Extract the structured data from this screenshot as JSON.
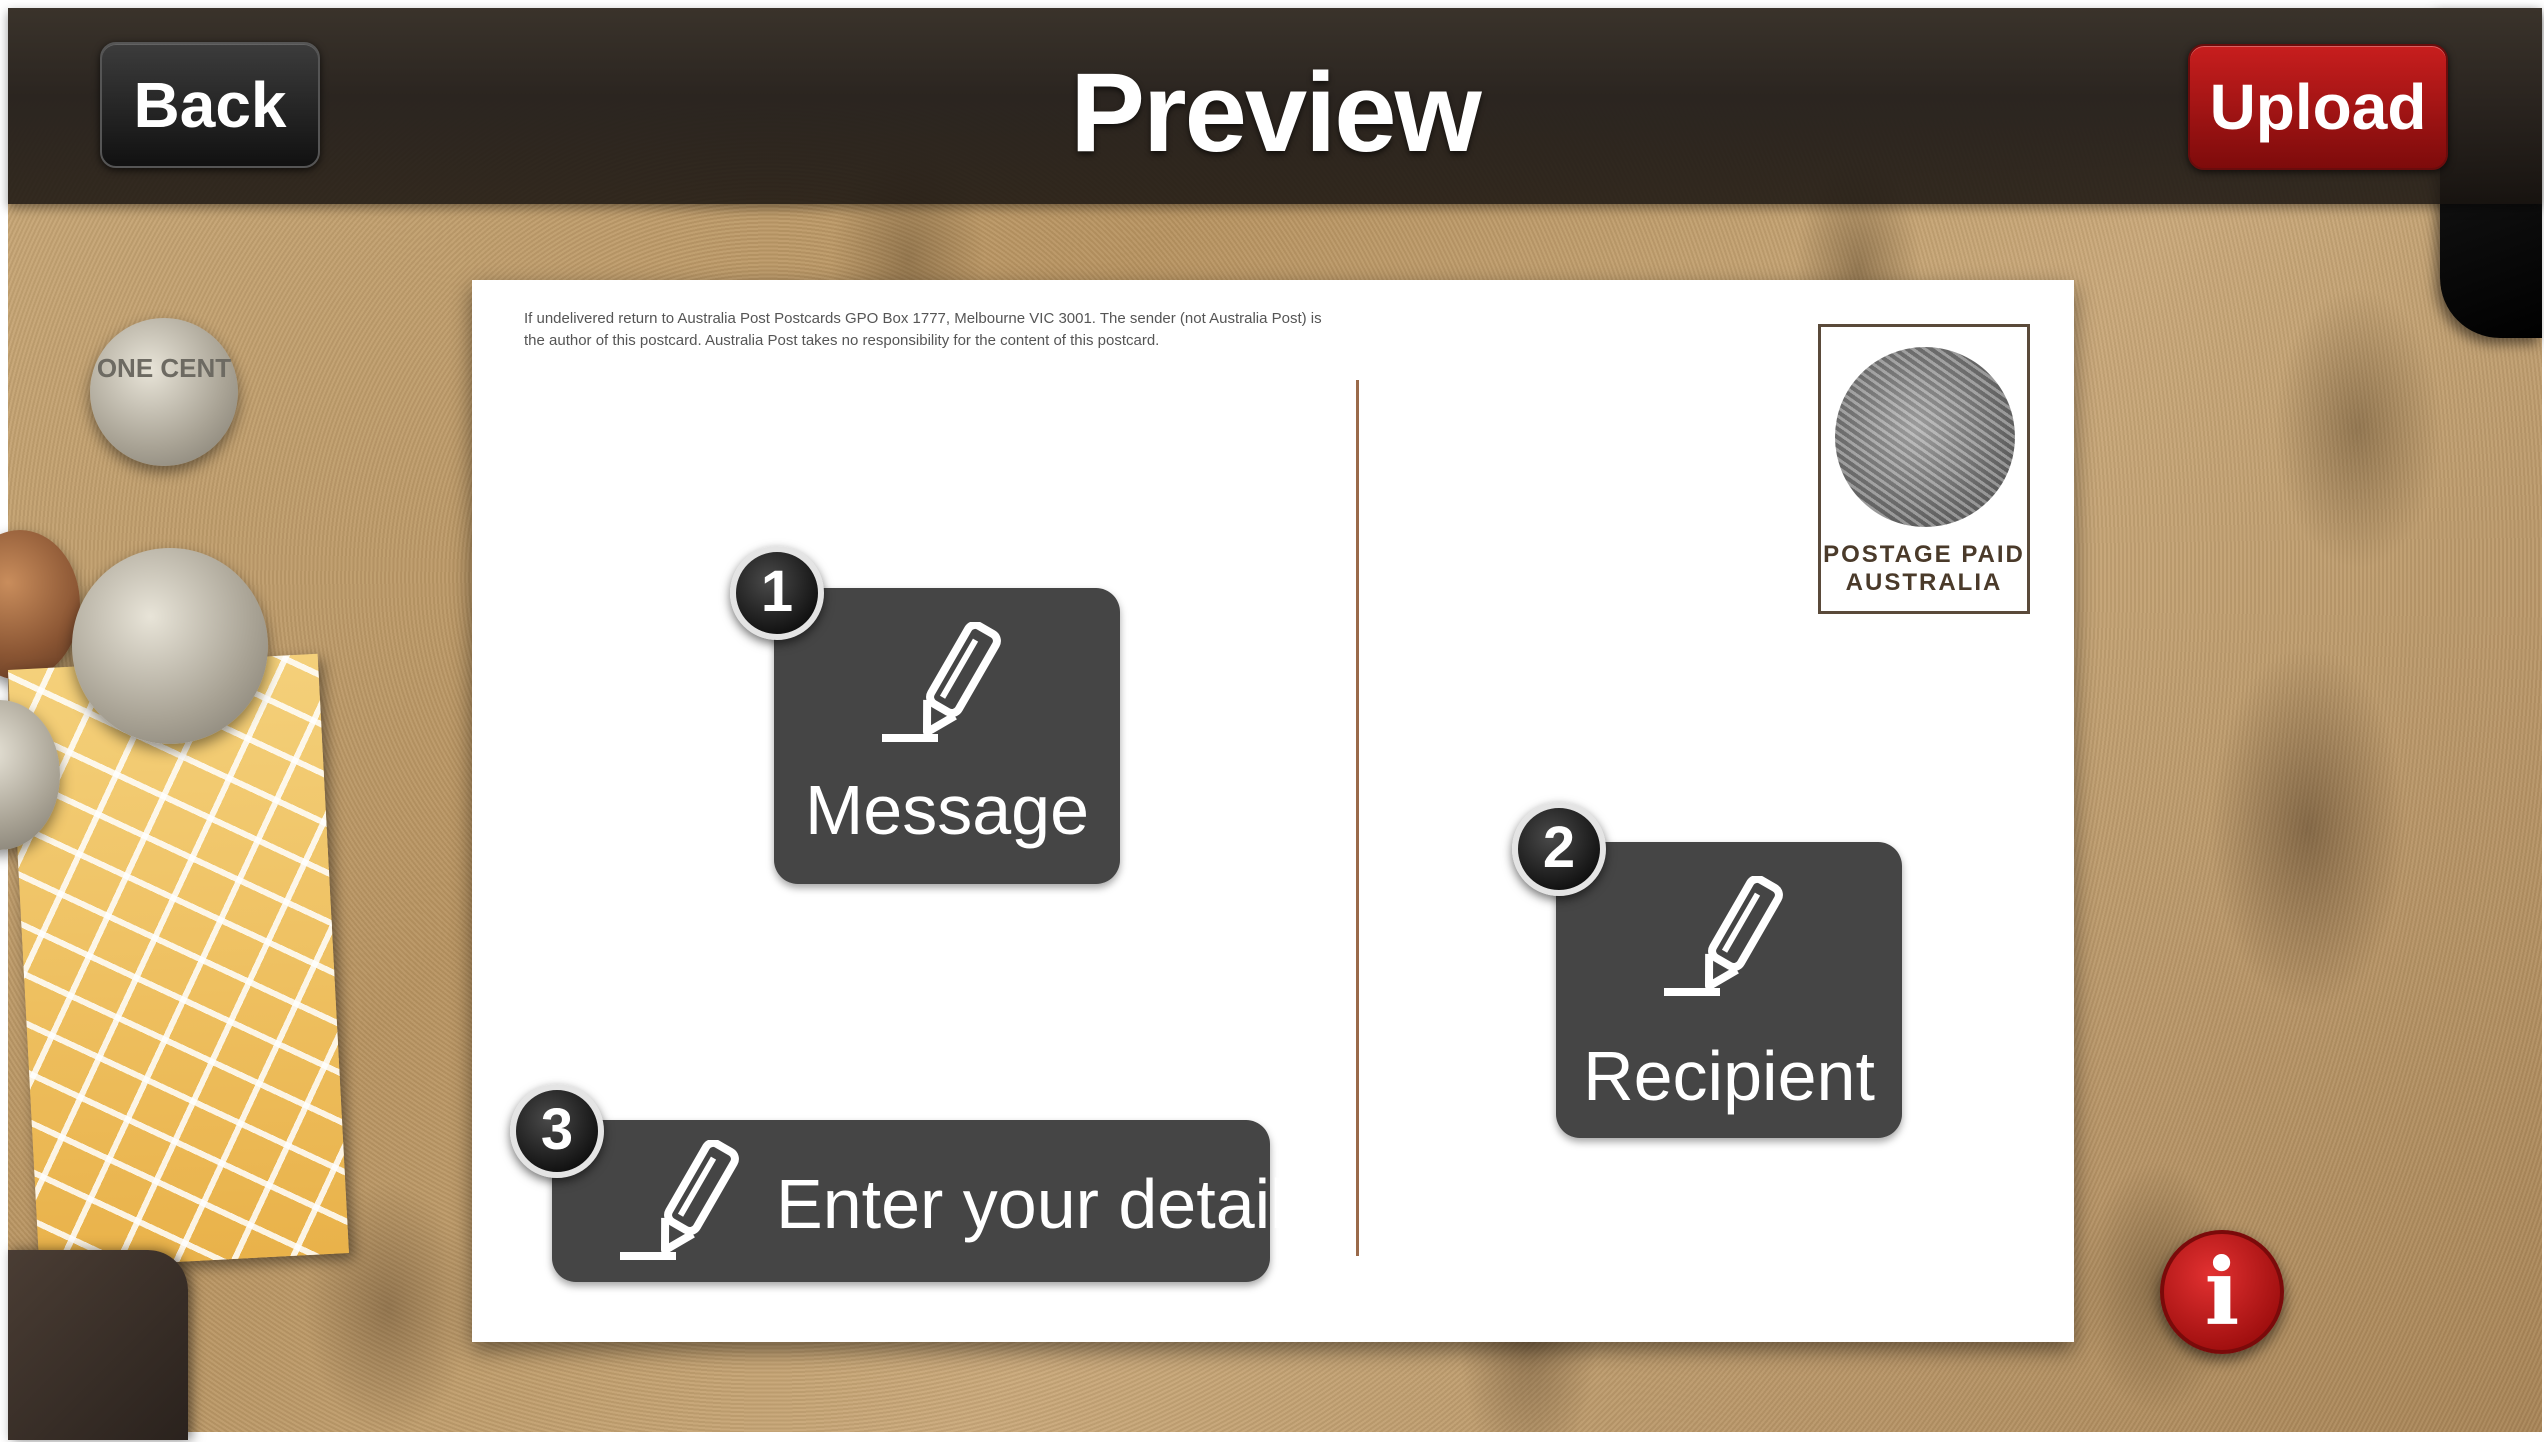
{
  "header": {
    "title": "Preview",
    "back_label": "Back",
    "upload_label": "Upload"
  },
  "decorations": {
    "coin_text": "ONE CENT"
  },
  "postcard": {
    "disclaimer": "If undelivered return to Australia Post Postcards GPO Box 1777, Melbourne VIC 3001. The sender (not Australia Post) is the author of this postcard. Australia Post takes no responsibility for the content of this postcard.",
    "stamp": {
      "line1": "POSTAGE PAID",
      "line2": "AUSTRALIA"
    },
    "steps": [
      {
        "number": "1",
        "label": "Message",
        "icon": "pencil-icon"
      },
      {
        "number": "2",
        "label": "Recipient",
        "icon": "pencil-icon"
      },
      {
        "number": "3",
        "label": "Enter your details",
        "icon": "pencil-icon"
      }
    ]
  },
  "info": {
    "symbol": "i"
  },
  "colors": {
    "upload_red": "#b01414",
    "button_dark": "#454545",
    "info_red": "#c81e1e"
  }
}
